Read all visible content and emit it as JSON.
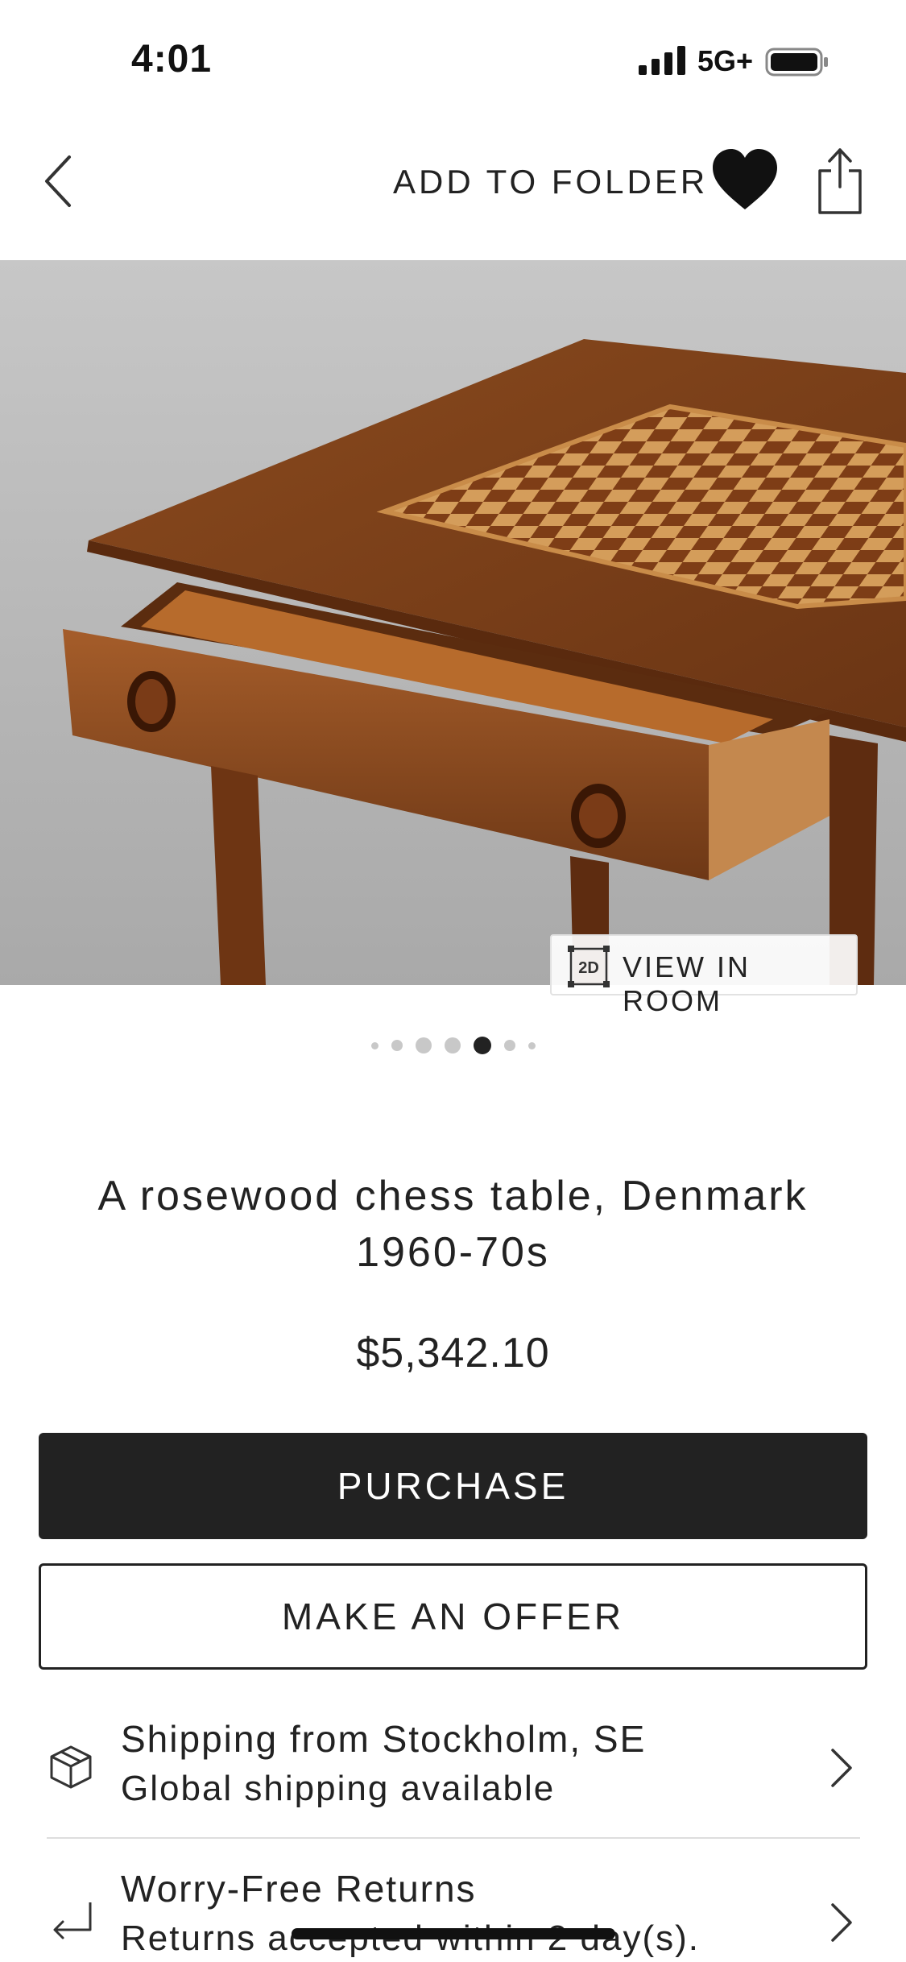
{
  "status_bar": {
    "time": "4:01",
    "network": "5G+"
  },
  "nav": {
    "add_to_folder": "ADD TO FOLDER",
    "back_icon": "chevron-left-icon",
    "favorite_icon": "heart-filled-icon",
    "share_icon": "share-icon"
  },
  "hero": {
    "view_in_room_badge": "2D",
    "view_in_room": "VIEW IN ROOM",
    "page_count": 7,
    "active_page": 5
  },
  "product": {
    "title_line1": "A rosewood chess table, Denmark",
    "title_line2": "1960-70s",
    "price": "$5,342.10"
  },
  "actions": {
    "purchase": "PURCHASE",
    "offer": "MAKE AN OFFER"
  },
  "info_rows": [
    {
      "icon": "package-icon",
      "title": "Shipping from Stockholm, SE",
      "subtitle": "Global shipping available"
    },
    {
      "icon": "return-arrow-icon",
      "title": "Worry-Free Returns",
      "subtitle": "Returns accepted within 2 day(s)."
    }
  ],
  "colors": {
    "primary": "#222222",
    "background": "#ffffff",
    "dot_inactive": "#c8c8c8",
    "dot_active": "#222222"
  }
}
